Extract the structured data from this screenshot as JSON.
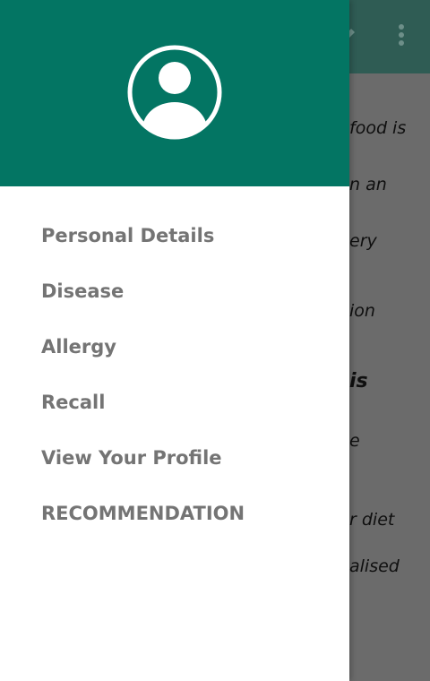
{
  "app_bar": {
    "edit_icon": "pencil-icon",
    "more_icon": "more-vert-icon"
  },
  "content_lines": [
    "food is",
    "n an",
    "ery",
    "ion",
    "is",
    "e",
    "r diet",
    "alised"
  ],
  "drawer": {
    "header_color": "#037563",
    "avatar_icon": "account-circle-icon",
    "menu_items": [
      "Personal Details",
      "Disease",
      "Allergy",
      "Recall",
      "View Your Profile",
      "RECOMMENDATION"
    ]
  }
}
